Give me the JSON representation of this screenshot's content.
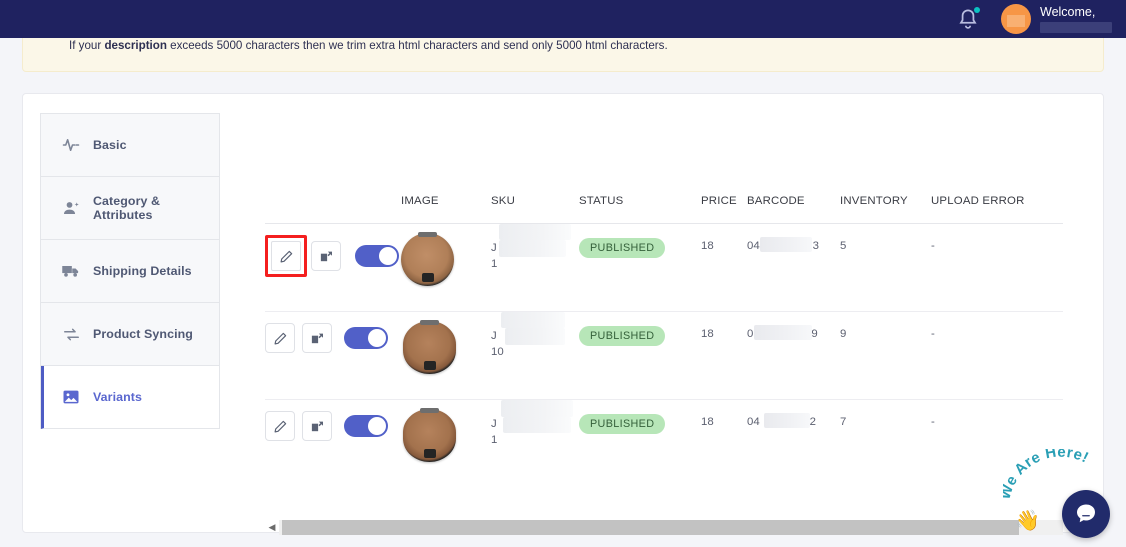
{
  "topbar": {
    "notification_icon": "bell-icon",
    "has_notification_dot": true,
    "welcome_text": "Welcome,",
    "username_redacted": "",
    "bg_color": "#1f2260"
  },
  "banner": {
    "text_prefix": "If your ",
    "text_bold": "description",
    "text_suffix": " exceeds 5000 characters then we trim extra html characters and send only 5000 html characters.",
    "bg_color": "#fbf7e8"
  },
  "sidebar": {
    "items": [
      {
        "label": "Basic",
        "icon": "activity-pulse-icon",
        "active": false
      },
      {
        "label": "Category & Attributes",
        "icon": "person-add-icon",
        "active": false
      },
      {
        "label": "Shipping Details",
        "icon": "truck-icon",
        "active": false
      },
      {
        "label": "Product Syncing",
        "icon": "sync-arrows-icon",
        "active": false
      },
      {
        "label": "Variants",
        "icon": "image-icon",
        "active": true
      }
    ],
    "active_color": "#5a67cf"
  },
  "table": {
    "headers": [
      "",
      "IMAGE",
      "SKU",
      "STATUS",
      "PRICE",
      "BARCODE",
      "INVENTORY",
      "UPLOAD ERROR"
    ],
    "rows": [
      {
        "edit_icon": "pencil-icon",
        "duplicate_icon": "duplicate-external-icon",
        "toggle_on": true,
        "highlighted": true,
        "image": "round-compact-powder",
        "sku_line1": "J",
        "sku_line2": "1",
        "status": "PUBLISHED",
        "price": "18",
        "barcode_prefix": "04",
        "barcode_suffix": "3",
        "inventory": "5",
        "upload_error": "-"
      },
      {
        "edit_icon": "pencil-icon",
        "duplicate_icon": "duplicate-external-icon",
        "toggle_on": true,
        "highlighted": false,
        "image": "round-compact-powder",
        "sku_line1": "J",
        "sku_line2": "10",
        "status": "PUBLISHED",
        "price": "18",
        "barcode_prefix": "0",
        "barcode_suffix": "9",
        "inventory": "9",
        "upload_error": "-"
      },
      {
        "edit_icon": "pencil-icon",
        "duplicate_icon": "duplicate-external-icon",
        "toggle_on": true,
        "highlighted": false,
        "image": "round-compact-powder",
        "sku_line1": "J",
        "sku_line2": "1",
        "status": "PUBLISHED",
        "price": "18",
        "barcode_prefix": "04",
        "barcode_suffix": "2",
        "inventory": "7",
        "upload_error": "-"
      }
    ],
    "status_badge_color": "#b7e6b8",
    "toggle_on_color": "#5160c8",
    "highlight_color": "#f41f1f"
  },
  "scrollbar": {
    "left_arrow_icon": "chevron-left-icon",
    "orientation": "horizontal"
  },
  "chat_widget": {
    "arc_text": "We Are Here!",
    "hand_icon": "waving-hand-icon",
    "bubble_icon": "chat-bubble-icon",
    "bubble_color": "#212b6b",
    "arc_text_color": "#2a9fb5"
  }
}
